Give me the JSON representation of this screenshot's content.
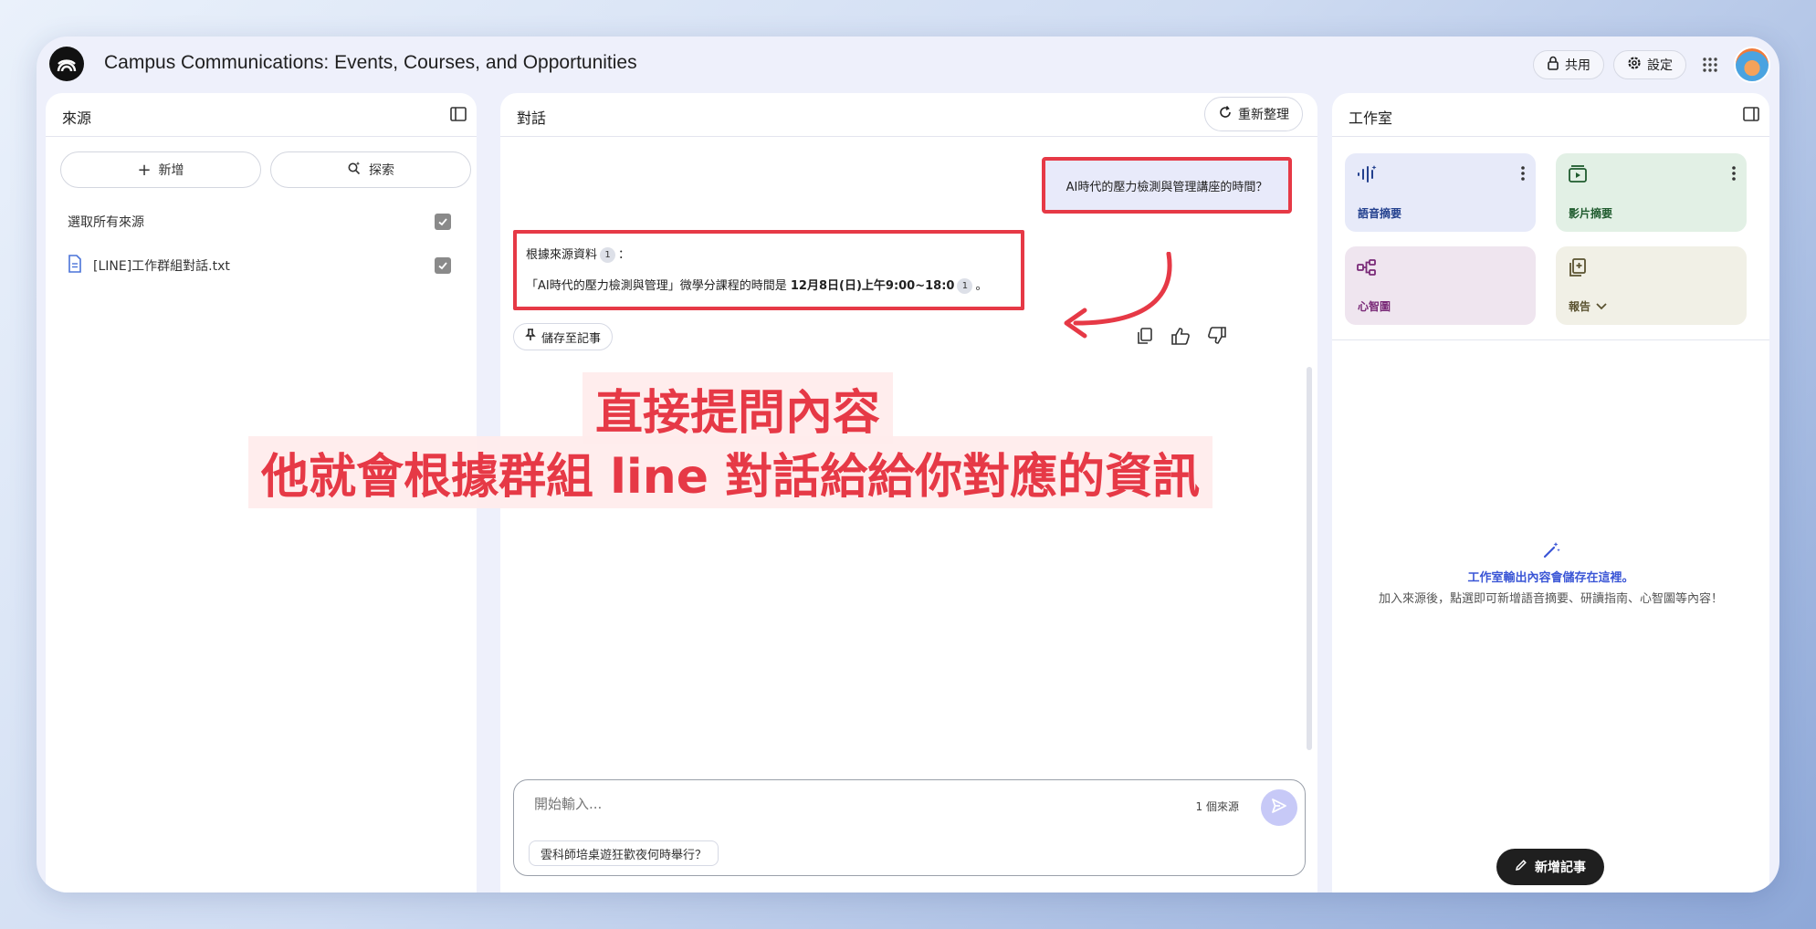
{
  "header": {
    "title": "Campus Communications: Events, Courses, and Opportunities",
    "share_label": "共用",
    "settings_label": "設定"
  },
  "sources": {
    "title": "來源",
    "add_label": "新增",
    "explore_label": "探索",
    "select_all_label": "選取所有來源",
    "items": [
      {
        "label": "[LINE]工作群組對話.txt"
      }
    ]
  },
  "chat": {
    "title": "對話",
    "refresh_label": "重新整理",
    "user_message": "AI時代的壓力檢測與管理講座的時間？",
    "answer_intro": "根據來源資料",
    "answer_intro_suffix": "：",
    "answer_text_prefix": "「AI時代的壓力檢測與管理」微學分課程的時間是 ",
    "answer_text_bold": "12月8日(日)上午9:00~18:0",
    "answer_text_suffix": "。",
    "citation_number": "1",
    "save_note_label": "儲存至記事",
    "input_placeholder": "開始輸入...",
    "source_count": "1 個來源",
    "suggestion": "雲科師培桌遊狂歡夜何時舉行？"
  },
  "studio": {
    "title": "工作室",
    "cards": [
      {
        "label": "語音摘要",
        "icon": "audio-wave-icon",
        "bg": "#e7eaf9",
        "color": "#23408e"
      },
      {
        "label": "影片摘要",
        "icon": "video-icon",
        "bg": "#e2f0e5",
        "color": "#1f5b2e"
      },
      {
        "label": "心智圖",
        "icon": "mindmap-icon",
        "bg": "#efe5ef",
        "color": "#7a2a78"
      },
      {
        "label": "報告",
        "icon": "report-icon",
        "bg": "#f1f0e6",
        "color": "#5a5230"
      }
    ],
    "empty_title": "工作室輸出內容會儲存在這裡。",
    "empty_sub": "加入來源後，點選即可新增語音摘要、研讀指南、心智圖等內容！",
    "new_note_label": "新增記事"
  },
  "overlay": {
    "line1": "直接提問內容",
    "line2": "他就會根據群組 line 對話給給你對應的資訊"
  },
  "colors": {
    "highlight_red": "#e63946",
    "accent_blue": "#3b56d6"
  }
}
